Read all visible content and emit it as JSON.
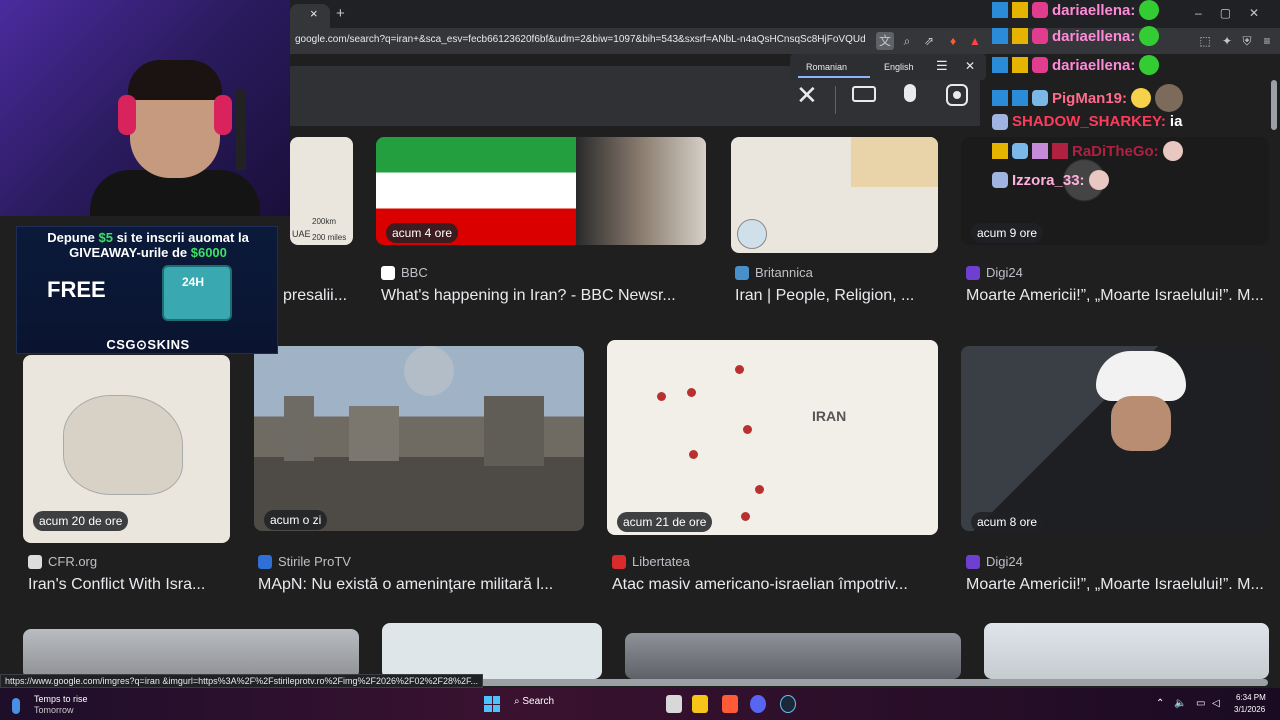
{
  "browser": {
    "tab_close": "×",
    "new_tab": "+",
    "url": "google.com/search?q=iran+&sca_esv=fecb66123620f6bf&udm=2&biw=1097&bih=543&sxsrf=ANbL-n4aQsHCnsqSc8HjFoVQUdoYDou...",
    "win_min": "–",
    "win_max": "▢",
    "win_close": "✕"
  },
  "translate_popup": {
    "lang_from": "Romanian",
    "lang_to": "English",
    "menu": "☰",
    "close": "✕"
  },
  "search": {
    "clear": "✕"
  },
  "row1": [
    {
      "badge": "",
      "source": "",
      "title": "presalii..."
    },
    {
      "badge": "acum 4 ore",
      "source": "BBC",
      "title": "What's happening in Iran? - BBC Newsr..."
    },
    {
      "badge": "",
      "source": "Britannica",
      "title": "Iran | People, Religion, ..."
    },
    {
      "badge": "acum 9 ore",
      "source": "Digi24",
      "title": "Moarte Americii!”, „Moarte Israelului!”. M..."
    }
  ],
  "row1_map_labels": {
    "uae": "UAE",
    "scale1": "200km",
    "scale2": "200 miles"
  },
  "row2": [
    {
      "badge": "acum 20 de ore",
      "source": "CFR.org",
      "title": "Iran's Conflict With Isra..."
    },
    {
      "badge": "acum o zi",
      "source": "Stirile ProTV",
      "title": "MApN: Nu există o ameninţare militară l..."
    },
    {
      "badge": "acum 21 de ore",
      "source": "Libertatea",
      "title": "Atac masiv americano-israelian împotriv..."
    },
    {
      "badge": "acum 8 ore",
      "source": "Digi24",
      "title": "Moarte Americii!”, „Moarte Israelului!”. M..."
    }
  ],
  "map_iran_label": "IRAN",
  "ad": {
    "line1_a": "Depune ",
    "line1_amount": "$5",
    "line1_b": " si te inscrii auomat la",
    "line2_a": "GIVEAWAY-urile de ",
    "line2_amount": "$6000",
    "free": "FREE",
    "case_label": "24H",
    "brand": "CSG⊙SKINS"
  },
  "chat": [
    {
      "name": "dariaellena:",
      "color": "#ff8ad8",
      "msg": ""
    },
    {
      "name": "dariaellena:",
      "color": "#ff8ad8",
      "msg": ""
    },
    {
      "name": "dariaellena:",
      "color": "#ff8ad8",
      "msg": ""
    },
    {
      "name": "PigMan19:",
      "color": "#ff6b8b",
      "msg": ""
    },
    {
      "name": "SHADOW_SHARKEY:",
      "color": "#ff3b5c",
      "msg": "ia"
    },
    {
      "name": "RaDiTheGo:",
      "color": "#b02040",
      "msg": ""
    },
    {
      "name": "Izzora_33:",
      "color": "#ffb0e0",
      "msg": ""
    }
  ],
  "status_link": "https://www.google.com/imgres?q=iran &imgurl=https%3A%2F%2Fstirileprotv.ro%2Fimg%2F2026%2F02%2F28%2F...",
  "taskbar": {
    "weather_line1": "Temps to rise",
    "weather_line2": "Tomorrow",
    "search": "Search",
    "time": "6:34 PM",
    "date": "3/1/2026"
  }
}
